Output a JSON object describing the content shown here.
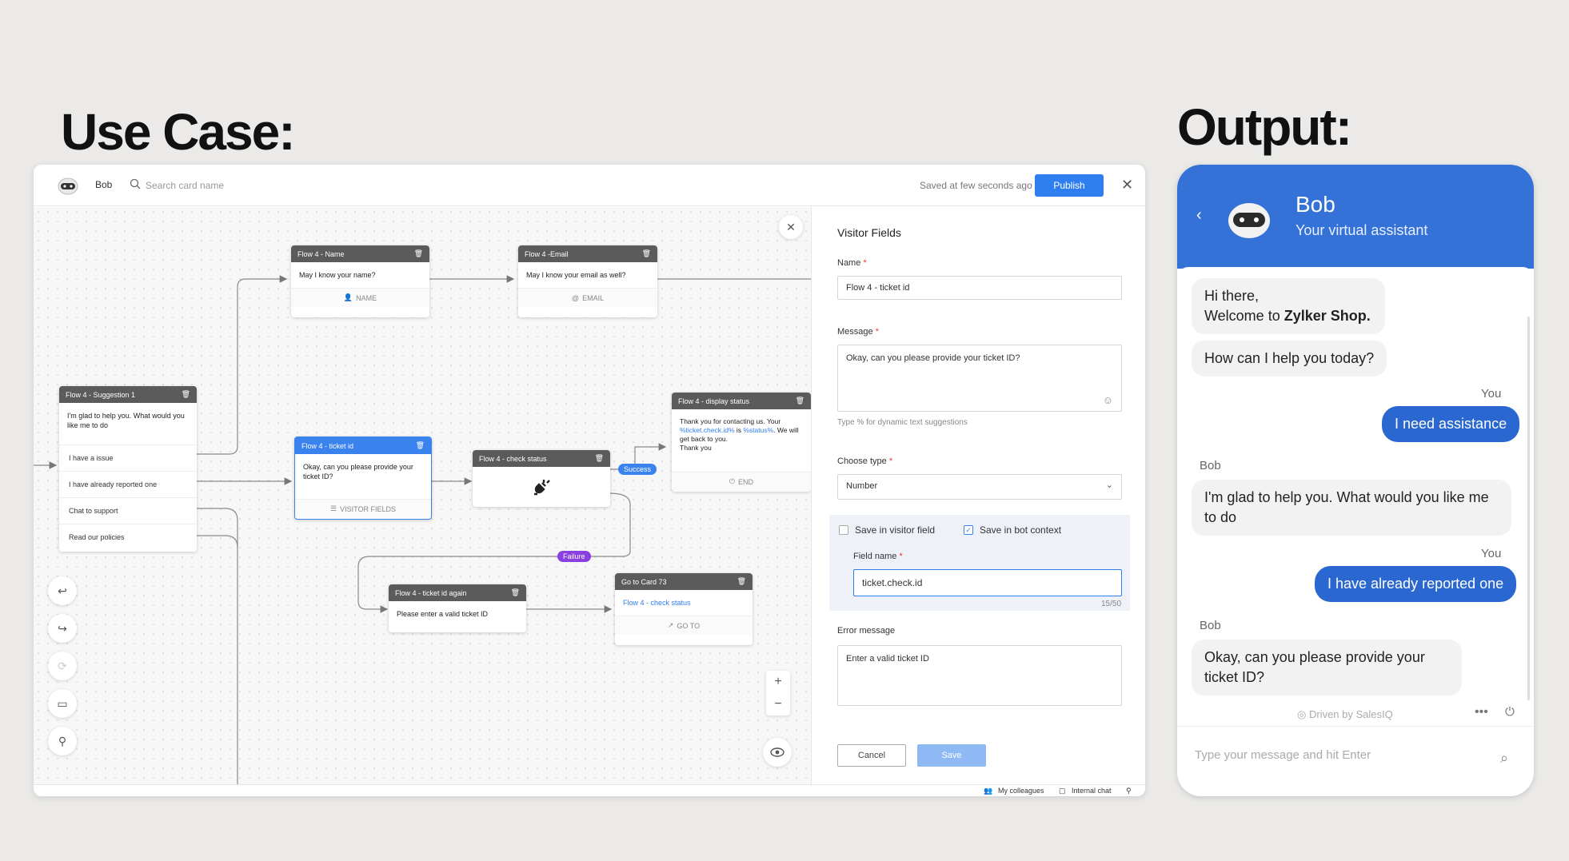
{
  "headings": {
    "use_case": "Use Case:",
    "output": "Output:"
  },
  "builder": {
    "bot_name": "Bob",
    "search_placeholder": "Search card name",
    "saved_text": "Saved at few seconds ago",
    "publish_label": "Publish",
    "cards": {
      "name": {
        "title": "Flow 4 - Name",
        "text": "May I know your name?",
        "footer": "NAME"
      },
      "email": {
        "title": "Flow 4 -Email",
        "text": "May I know your email as well?",
        "footer": "EMAIL"
      },
      "suggestion": {
        "title": "Flow 4 - Suggestion 1",
        "text": "I'm glad to help you. What would you like me to do",
        "options": [
          "I have a issue",
          "I have already reported one",
          "Chat to support",
          "Read our policies"
        ]
      },
      "ticket": {
        "title": "Flow 4 - ticket id",
        "text": "Okay, can you please provide your ticket ID?",
        "footer": "VISITOR FIELDS"
      },
      "check": {
        "title": "Flow 4 - check status"
      },
      "display": {
        "title": "Flow 4 - display status",
        "text_a": "Thank you for contacting us. Your ",
        "var_a": "%ticket.check.id%",
        "text_b": " is ",
        "var_b": "%status%",
        "text_c": ". We will get back to you.",
        "text_d": "Thank you",
        "footer": "END"
      },
      "again": {
        "title": "Flow 4 - ticket id again",
        "text": "Please enter a valid ticket ID"
      },
      "goto": {
        "title": "Go to Card 73",
        "link": "Flow 4 - check status",
        "footer": "GO TO"
      }
    },
    "pills": {
      "success": "Success",
      "failure": "Failure"
    },
    "colors": {
      "accent": "#2e7ef0",
      "success": "#3a82ee",
      "failure": "#8a3fe0"
    },
    "panel": {
      "title": "Visitor Fields",
      "name_label": "Name",
      "name_value": "Flow 4 - ticket id",
      "message_label": "Message",
      "message_value": "Okay, can you please provide your ticket ID?",
      "message_hint": "Type % for dynamic text suggestions",
      "type_label": "Choose type",
      "type_value": "Number",
      "save_visitor": "Save in visitor field",
      "save_context": "Save in bot context",
      "field_label": "Field name",
      "field_value": "ticket.check.id",
      "field_count": "15/50",
      "error_label": "Error message",
      "error_value": "Enter a valid ticket ID",
      "cancel": "Cancel",
      "save": "Save",
      "required_mark": "*"
    },
    "bottombar": {
      "colleagues": "My colleagues",
      "internal": "Internal chat"
    }
  },
  "chat": {
    "title": "Bob",
    "subtitle": "Your virtual assistant",
    "msg1_line1": "Hi there,",
    "msg1_line2_prefix": "Welcome to ",
    "msg1_brand": "Zylker Shop.",
    "msg2": "How can I help you today?",
    "you": "You",
    "bob": "Bob",
    "user1": "I need assistance",
    "bot3": "I'm glad to help you. What would you like me to do",
    "user2": "I have already reported one",
    "bot4": "Okay, can you please provide your ticket ID?",
    "brand": "Driven by SalesIQ",
    "input_placeholder": "Type your message and hit Enter"
  }
}
